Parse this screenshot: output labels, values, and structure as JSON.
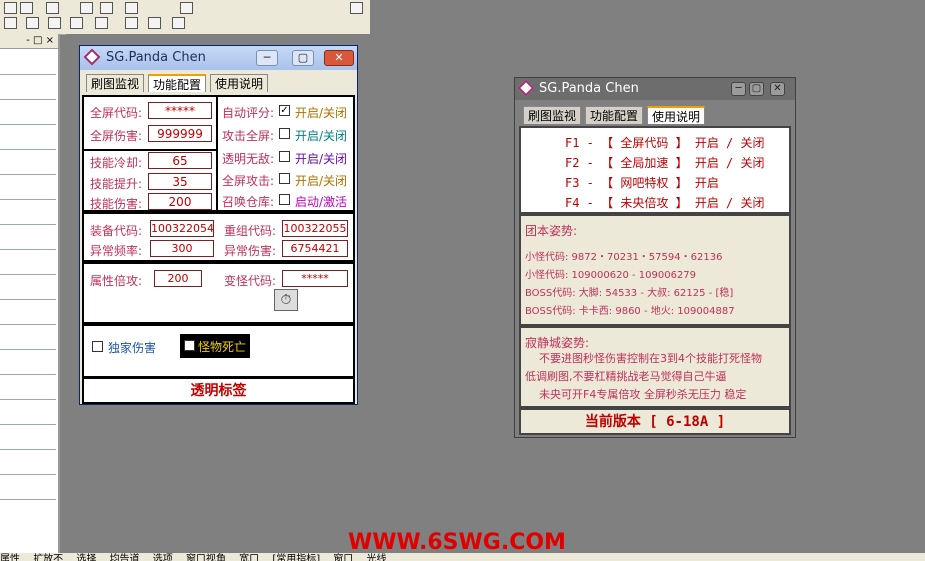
{
  "win1": {
    "title": "SG.Panda Chen",
    "tabs": [
      "刷图监视",
      "功能配置",
      "使用说明"
    ],
    "fields": [
      {
        "label": "全屏代码:",
        "value": "*****"
      },
      {
        "label": "全屏伤害:",
        "value": "999999"
      },
      {
        "label": "技能冷却:",
        "value": "65"
      },
      {
        "label": "技能提升:",
        "value": "35"
      },
      {
        "label": "技能伤害:",
        "value": "200"
      },
      {
        "label": "装备代码:",
        "value": "100322054"
      },
      {
        "label": "异常频率:",
        "value": "300"
      },
      {
        "label": "重组代码:",
        "value": "100322055"
      },
      {
        "label": "异常伤害:",
        "value": "6754421"
      },
      {
        "label": "属性倍攻:",
        "value": "200"
      },
      {
        "label": "变怪代码:",
        "value": "*****"
      }
    ],
    "toggles": [
      {
        "label": "自动评分:",
        "checked": true,
        "text": "开启/关闭",
        "color": "#b07000"
      },
      {
        "label": "攻击全屏:",
        "checked": false,
        "text": "开启/关闭",
        "color": "#008080"
      },
      {
        "label": "透明无敌:",
        "checked": false,
        "text": "开启/关闭",
        "color": "#6a0dad"
      },
      {
        "label": "全屏攻击:",
        "checked": false,
        "text": "开启/关闭",
        "color": "#b07000"
      },
      {
        "label": "召唤仓库:",
        "checked": false,
        "text": "启动/激活",
        "color": "#c000c0"
      }
    ],
    "check_exclusive": "独家伤害",
    "check_death": "怪物死亡",
    "bottom_label": "透明标签"
  },
  "win2": {
    "title": "SG.Panda Chen",
    "tabs": [
      "刷图监视",
      "功能配置",
      "使用说明"
    ],
    "hotkeys": [
      {
        "key": "F1 -",
        "name": "【 全屏代码 】",
        "action": "开启 / 关闭"
      },
      {
        "key": "F2 -",
        "name": "【 全局加速 】",
        "action": "开启 / 关闭"
      },
      {
        "key": "F3 -",
        "name": "【 网吧特权 】",
        "action": "开启"
      },
      {
        "key": "F4 -",
        "name": "【 未央倍攻 】",
        "action": "开启 / 关闭"
      }
    ],
    "team_title": "团本姿势:",
    "team_lines": [
      "小怪代码: 9872・70231・57594・62136",
      "小怪代码:  109000620 - 109006279",
      "BOSS代码: 大脚: 54533 - 大叔: 62125 - [稳]",
      "BOSS代码: 卡卡西: 9860 - 地火: 109004887"
    ],
    "city_title": "寂静城姿势:",
    "city_lines": [
      "不要进图秒怪伤害控制在3到4个技能打死怪物",
      "低调刷图,不要杠精挑战老马觉得自己牛逼",
      "未央可开F4专属倍攻 全屏秒杀无压力 稳定"
    ],
    "version": "当前版本 [ 6-18A ]"
  },
  "watermark": "WWW.6SWG.COM",
  "bottom_tabs": [
    "属性",
    "扩放不",
    "选择",
    "均告道",
    "选项",
    "窗口视角",
    "宽口",
    "[常用指标]",
    "窗口",
    "光线"
  ]
}
